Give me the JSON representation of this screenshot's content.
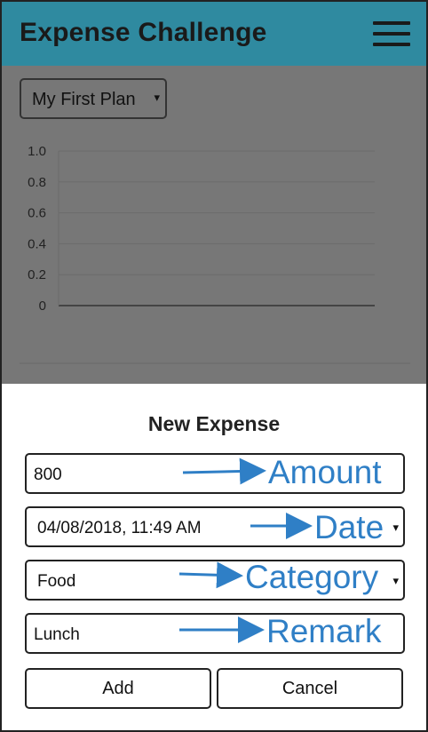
{
  "app": {
    "title": "Expense Challenge"
  },
  "plan_selector": {
    "selected": "My First Plan"
  },
  "chart_data": {
    "type": "line",
    "title": "",
    "xlabel": "",
    "ylabel": "",
    "ylim": [
      0,
      1.0
    ],
    "y_ticks": [
      "1.0",
      "0.8",
      "0.6",
      "0.4",
      "0.2",
      "0"
    ],
    "grid": true,
    "series": []
  },
  "dialog": {
    "title": "New Expense",
    "amount_value": "800",
    "date_value": "04/08/2018, 11:49 AM",
    "category_value": "Food",
    "remark_value": "Lunch",
    "add_label": "Add",
    "cancel_label": "Cancel"
  },
  "annotations": {
    "amount": "Amount",
    "date": "Date",
    "category": "Category",
    "remark": "Remark",
    "color": "#2f7fc6"
  },
  "icons": {
    "menu": "hamburger-menu-icon",
    "dropdown": "caret-down-icon",
    "caret_glyph": "▾"
  },
  "colors": {
    "appbar": "#2f8aa0",
    "overlay": "#777777"
  }
}
